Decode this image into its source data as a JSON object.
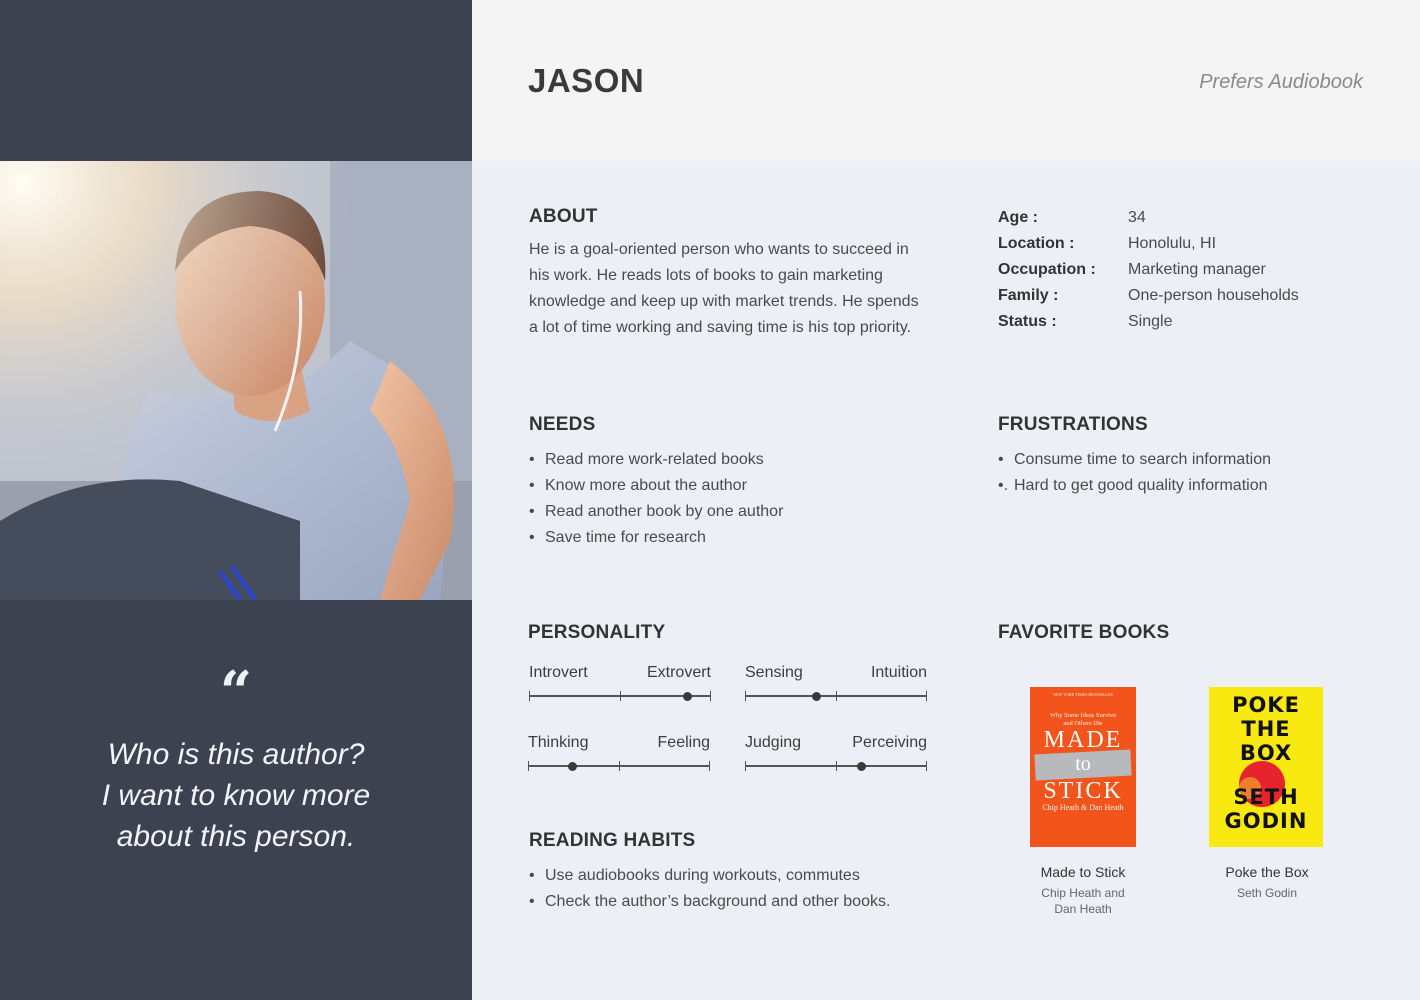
{
  "persona": {
    "name": "JASON",
    "preference": "Prefers Audiobook"
  },
  "quote": {
    "mark": "“",
    "lines": [
      "Who is this author?",
      "I want to know more",
      "about this person."
    ]
  },
  "about": {
    "title": "ABOUT",
    "text": "He is a goal-oriented person who wants to succeed in his work. He reads lots of books to gain marketing knowledge and keep up with market trends. He spends a lot of time working and saving time is his top priority."
  },
  "facts": [
    {
      "label": "Age :",
      "value": "34"
    },
    {
      "label": "Location :",
      "value": "Honolulu, HI"
    },
    {
      "label": "Occupation :",
      "value": "Marketing manager"
    },
    {
      "label": "Family :",
      "value": "One-person households"
    },
    {
      "label": "Status :",
      "value": "Single"
    }
  ],
  "needs": {
    "title": "NEEDS",
    "items": [
      {
        "bullet": "•",
        "text": "Read more work-related books"
      },
      {
        "bullet": "•",
        "text": "Know more about the author"
      },
      {
        "bullet": "•",
        "text": "Read another book by one author"
      },
      {
        "bullet": "•",
        "text": "Save time for research"
      }
    ]
  },
  "frustrations": {
    "title": "FRUSTRATIONS",
    "items": [
      {
        "bullet": "•",
        "text": "Consume time to search information"
      },
      {
        "bullet": "•.",
        "text": "Hard to get good quality information"
      }
    ]
  },
  "personality": {
    "title": "PERSONALITY",
    "traits": [
      {
        "left": "Introvert",
        "right": "Extrovert",
        "level": 0.87
      },
      {
        "left": "Sensing",
        "right": "Intuition",
        "level": 0.39
      },
      {
        "left": "Thinking",
        "right": "Feeling",
        "level": 0.24
      },
      {
        "left": "Judging",
        "right": "Perceiving",
        "level": 0.64
      }
    ]
  },
  "reading_habits": {
    "title": "READING HABITS",
    "items": [
      {
        "bullet": "•",
        "text": "Use audiobooks during workouts, commutes"
      },
      {
        "bullet": "•",
        "text": "Check the author’s background and other books."
      }
    ]
  },
  "favorite_books": {
    "title": "FAVORITE BOOKS",
    "books": [
      {
        "title": "Made to Stick",
        "author_lines": [
          "Chip Heath and",
          "Dan Heath"
        ],
        "cover_color": "#f2541b",
        "cover_text": {
          "top": "NEW YORK TIMES BESTSELLER",
          "sub1": "Why Some Ideas Survive",
          "sub2": "and Others Die",
          "word1": "MADE",
          "word2": "to",
          "word3": "STICK",
          "authors": "Chip Heath & Dan Heath"
        }
      },
      {
        "title": "Poke the Box",
        "author_lines": [
          "Seth Godin"
        ],
        "cover_color": "#f8ea10",
        "cover_text": {
          "line1": "POKE",
          "line2": "THE",
          "line3": "BOX",
          "line4": "SETH",
          "line5": "GODIN"
        }
      }
    ]
  }
}
